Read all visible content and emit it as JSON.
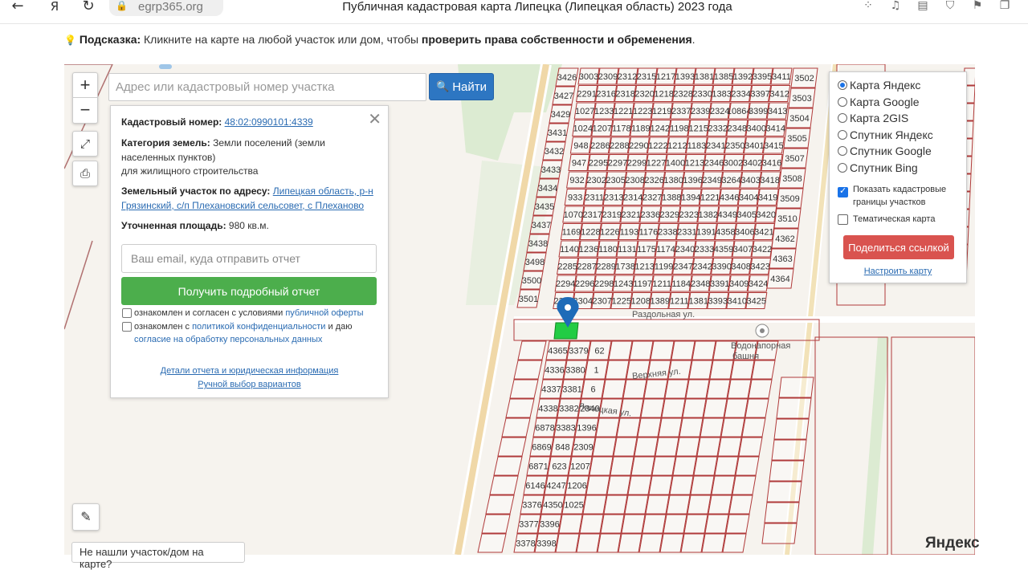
{
  "browser": {
    "back_icon": "arrow-left-icon",
    "site_label": "Я",
    "reload_icon": "reload-icon",
    "url": "egrp365.org",
    "title": "Публичная кадастровая карта Липецка (Липецкая область) 2023 года"
  },
  "hint": {
    "prefix": "Подсказка:",
    "text": " Кликните на карте на любой участок или дом, чтобы ",
    "bold_text": "проверить права собственности и обременения",
    "suffix": "."
  },
  "map_controls": {
    "zoom_in": "+",
    "zoom_out": "−"
  },
  "search": {
    "placeholder": "Адрес или кадастровый номер участка",
    "button_label": "Найти"
  },
  "parcel_info": {
    "cadastral_label": "Кадастровый номер:",
    "cadastral_number": "48:02:0990101:4339",
    "category_label": "Категория земель:",
    "category_value_1": " Земли поселений (земли",
    "category_value_2": "населенных пунктов)",
    "category_value_3": "для жилищного строительства",
    "address_label": "Земельный участок по адресу:",
    "address_value_1": "Липецкая область, р-н",
    "address_value_2": "Грязинский, с/п Плехановский сельсовет, с Плеханово",
    "area_label": "Уточненная площадь:",
    "area_value": " 980 кв.м.",
    "email_placeholder": "Ваш email, куда отправить отчет",
    "report_button": "Получить подробный отчет",
    "agree1_text": "ознакомлен и согласен с условиями ",
    "agree1_link": "публичной оферты",
    "agree2_text": "ознакомлен с ",
    "agree2_link": "политикой конфиденциальности",
    "agree2_text2": " и даю",
    "agree2_link2": "согласие на обработку персональных данных",
    "details_link": "Детали отчета и юридическая информация",
    "manual_link": "Ручной выбор вариантов"
  },
  "layers": {
    "options": [
      "Карта Яндекс",
      "Карта Google",
      "Карта 2GIS",
      "Спутник Яндекс",
      "Спутник Google",
      "Спутник Bing"
    ],
    "selected": "Карта Яндекс",
    "show_borders_1": "Показать кадастровые",
    "show_borders_2": "границы участков",
    "thematic": "Тематическая карта",
    "share_button": "Поделиться ссылкой",
    "setup_link": "Настроить карту"
  },
  "map_labels": {
    "street_1": "Раздольная ул.",
    "street_2": "Верхняя ул.",
    "street_3": "Липецкая ул.",
    "tower": "Водонапорная",
    "tower_2": "башня",
    "parcel_nums": [
      "3003",
      "2291",
      "1027",
      "1024",
      "948",
      "947",
      "932",
      "933",
      "1070",
      "1169",
      "1140",
      "2285",
      "2294",
      "2301",
      "2309",
      "2316",
      "1233",
      "1207",
      "2286",
      "2295",
      "2302",
      "2311",
      "2317",
      "1228",
      "1236",
      "2287",
      "2296",
      "2304",
      "2312",
      "2318",
      "1221",
      "1178",
      "2288",
      "2297",
      "2305",
      "2313",
      "2319",
      "1226",
      "1180",
      "2289",
      "2298",
      "2307",
      "2315",
      "2320",
      "1223",
      "1189",
      "2290",
      "2299",
      "2308",
      "2314",
      "2321",
      "1193",
      "1131",
      "1738",
      "1243",
      "1225",
      "1217",
      "1218",
      "1219",
      "1242",
      "1222",
      "1227",
      "2326",
      "2327",
      "2336",
      "1176",
      "1175",
      "1213",
      "1197",
      "1208",
      "1393",
      "2328",
      "2337",
      "1198",
      "1212",
      "1400",
      "1380",
      "1388",
      "2329",
      "2338",
      "1174",
      "1199",
      "1211",
      "1389",
      "1381",
      "2330",
      "2339",
      "1215",
      "1183",
      "1213",
      "1396",
      "1394",
      "2323",
      "2331",
      "2340",
      "2347",
      "1184",
      "1211",
      "1385",
      "1383",
      "2324",
      "2332",
      "2341",
      "2346",
      "2349",
      "1221",
      "1382",
      "1391",
      "2333",
      "2342",
      "2348",
      "1381",
      "1392",
      "2334",
      "10864",
      "2348",
      "2350",
      "3002",
      "3264",
      "4346",
      "4349",
      "4358",
      "4359",
      "3390",
      "3391",
      "3393",
      "3395",
      "3397",
      "3399",
      "3400",
      "3401",
      "3402",
      "3403",
      "3404",
      "3405",
      "3406",
      "3407",
      "3408",
      "3409",
      "3410",
      "3411",
      "3412",
      "3413",
      "3414",
      "3415",
      "3416",
      "3418",
      "3419",
      "3420",
      "3421",
      "3422",
      "3423",
      "3424",
      "3425",
      "3426",
      "3427",
      "3429",
      "3431",
      "3432",
      "3433",
      "3434",
      "3435",
      "3437",
      "3438",
      "3498",
      "3500",
      "3501",
      "3502",
      "3503",
      "3504",
      "3505",
      "3507",
      "3508",
      "3509",
      "3510",
      "4362",
      "4363",
      "4364",
      "4365",
      "4336",
      "4337",
      "4338",
      "6878",
      "6869",
      "6871",
      "6146",
      "3376",
      "3377",
      "3378",
      "3379",
      "3380",
      "3381",
      "3382",
      "3383",
      "848",
      "623",
      "4247",
      "4350",
      "3396",
      "3398",
      "62",
      "1",
      "6",
      "2340",
      "1396",
      "2309",
      "1207",
      "1206",
      "1025"
    ]
  },
  "bottom": {
    "ruler_icon": "ruler-icon",
    "not_found": "Не нашли участок/дом на карте?",
    "yandex": "Яндекс"
  }
}
